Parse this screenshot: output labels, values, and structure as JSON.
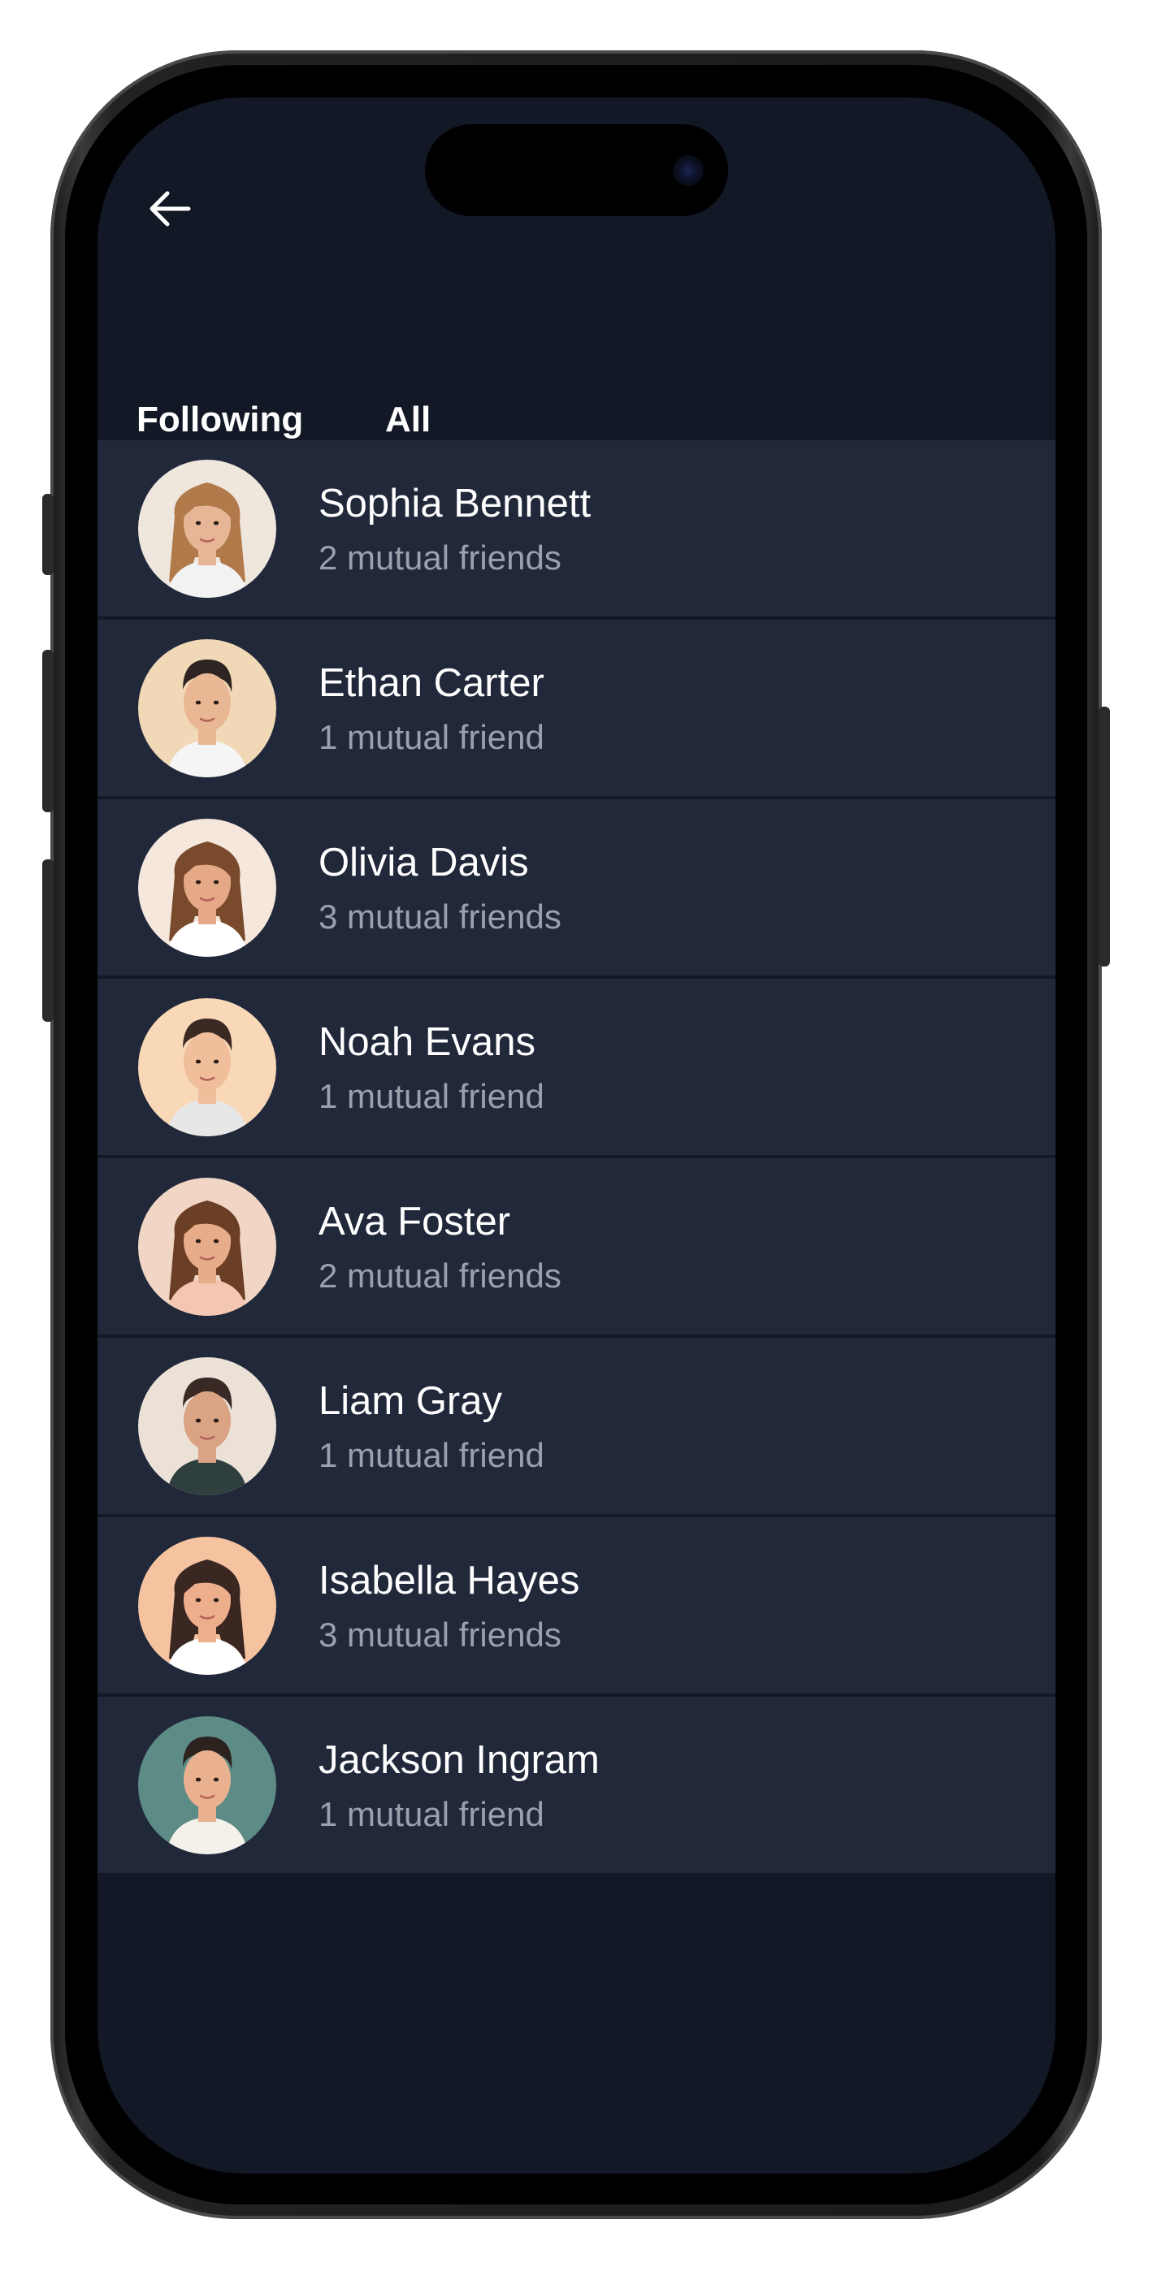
{
  "header": {
    "back_icon": "arrow-left-icon"
  },
  "tabs": [
    {
      "label": "Following",
      "active": true
    },
    {
      "label": "All",
      "active": false
    }
  ],
  "people": [
    {
      "name": "Sophia Bennett",
      "mutual": "2 mutual friends",
      "avatar": {
        "bg": "#efe6de",
        "skin": "#e7b696",
        "hair": "#b07a4a",
        "shirt": "#f2f2f2",
        "long_hair": true
      }
    },
    {
      "name": "Ethan Carter",
      "mutual": "1 mutual friend",
      "avatar": {
        "bg": "#f1d8b6",
        "skin": "#e9b793",
        "hair": "#2e2522",
        "shirt": "#f5f5f5",
        "long_hair": false
      }
    },
    {
      "name": "Olivia Davis",
      "mutual": "3 mutual friends",
      "avatar": {
        "bg": "#f5e7dc",
        "skin": "#e6a987",
        "hair": "#7a4a2d",
        "shirt": "#ffffff",
        "long_hair": true
      }
    },
    {
      "name": "Noah Evans",
      "mutual": "1 mutual friend",
      "avatar": {
        "bg": "#f9d8b8",
        "skin": "#f0be9a",
        "hair": "#3b2a23",
        "shirt": "#e7e7e7",
        "long_hair": false
      }
    },
    {
      "name": "Ava Foster",
      "mutual": "2 mutual friends",
      "avatar": {
        "bg": "#f1d6c5",
        "skin": "#e7ac8a",
        "hair": "#6b3f25",
        "shirt": "#f3c7b1",
        "long_hair": true
      }
    },
    {
      "name": "Liam Gray",
      "mutual": "1 mutual friend",
      "avatar": {
        "bg": "#ebe1d7",
        "skin": "#d9a384",
        "hair": "#3a2a25",
        "shirt": "#2f3f3d",
        "long_hair": false
      }
    },
    {
      "name": "Isabella Hayes",
      "mutual": "3 mutual friends",
      "avatar": {
        "bg": "#f6c3a1",
        "skin": "#edae8c",
        "hair": "#3a2722",
        "shirt": "#ffffff",
        "long_hair": true
      }
    },
    {
      "name": "Jackson Ingram",
      "mutual": "1 mutual friend",
      "avatar": {
        "bg": "#5d8b86",
        "skin": "#e9b190",
        "hair": "#2c231f",
        "shirt": "#f4f1ea",
        "long_hair": false
      }
    }
  ],
  "colors": {
    "screen_bg": "#131826",
    "row_bg": "#20283a",
    "secondary_text": "#9aa1ad"
  }
}
